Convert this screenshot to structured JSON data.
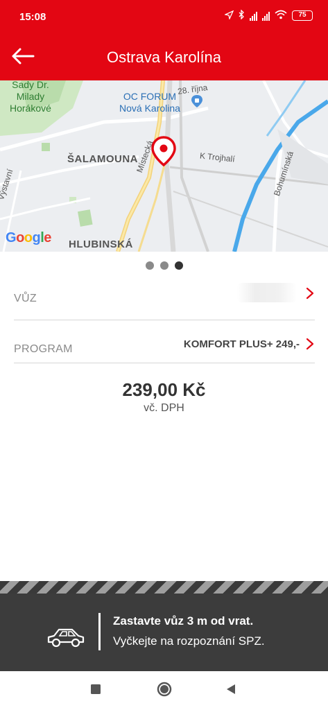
{
  "status_bar": {
    "time": "15:08",
    "battery": "75"
  },
  "app_bar": {
    "title": "Ostrava Karolína",
    "back_icon": "arrow-left-icon"
  },
  "map": {
    "labels": {
      "park": [
        "Sady Dr.",
        "Milady",
        "Horákové"
      ],
      "poi": [
        "OC FORUM",
        "Nová Karolina"
      ],
      "street_28_rijna": "28. října",
      "salamouna": "ŠALAMOUNA",
      "trojhali": "K Trojhalí",
      "mistecka": "Místecká",
      "vystavni": "Výstavní",
      "bohuminska": "Bohumínská",
      "hlubinska": "HLUBINSKÁ"
    },
    "google_logo": "Google",
    "marker_icon": "location-pin-icon"
  },
  "carousel": {
    "page_count": 3,
    "active_index": 2
  },
  "rows": {
    "car": {
      "label": "VŮZ",
      "value": ""
    },
    "program": {
      "label": "PROGRAM",
      "value": "KOMFORT PLUS+ 249,-"
    }
  },
  "price": {
    "amount": "239,00 Kč",
    "vat_note": "vč. DPH"
  },
  "banner": {
    "line1": "Zastavte vůz 3 m od vrat.",
    "line2": "Vyčkejte na rozpoznání SPZ.",
    "icon": "car-icon"
  },
  "colors": {
    "brand_red": "#e30613",
    "banner_dark": "#3a3a3a"
  }
}
